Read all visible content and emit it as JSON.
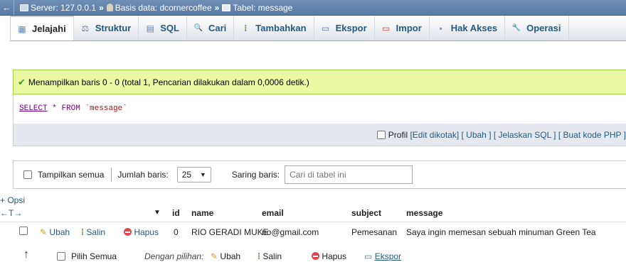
{
  "breadcrumb": {
    "back": "←",
    "server": "Server: 127.0.0.1",
    "database": "Basis data: dcornercoffee",
    "table": "Tabel: message",
    "separator": "»"
  },
  "tabs": [
    {
      "label": "Jelajahi",
      "icon": "browse-icon",
      "glyph": "▦"
    },
    {
      "label": "Struktur",
      "icon": "structure-icon",
      "glyph": "⚖"
    },
    {
      "label": "SQL",
      "icon": "sql-icon",
      "glyph": "▤"
    },
    {
      "label": "Cari",
      "icon": "search-icon",
      "glyph": "🔍"
    },
    {
      "label": "Tambahkan",
      "icon": "insert-icon",
      "glyph": "⁞"
    },
    {
      "label": "Ekspor",
      "icon": "export-icon",
      "glyph": "▭"
    },
    {
      "label": "Impor",
      "icon": "import-icon",
      "glyph": "▭"
    },
    {
      "label": "Hak Akses",
      "icon": "privileges-icon",
      "glyph": "▪"
    },
    {
      "label": "Operasi",
      "icon": "wrench-icon",
      "glyph": "🔧"
    }
  ],
  "message": {
    "text": "Menampilkan baris 0 - 0 (total 1, Pencarian dilakukan dalam 0,0006 detik.)",
    "check": "✔"
  },
  "sql": {
    "select": "SELECT",
    "star": "*",
    "from": "FROM",
    "table": "`message`"
  },
  "sql_actions": {
    "profile": "Profil",
    "edit_inline": "[Edit dikotak]",
    "edit": "[ Ubah ]",
    "explain": "[ Jelaskan SQL ]",
    "create_code": "[ Buat kode PHP ]"
  },
  "navigation": {
    "show_all": "Tampilkan semua",
    "rows_label": "Jumlah baris:",
    "rows_value": "25",
    "filter_label": "Saring baris:",
    "filter_placeholder": "Cari di tabel ini"
  },
  "options_link": "+ Opsi",
  "table": {
    "arrows": "←T→",
    "sort_arrow": "▼",
    "columns": [
      "id",
      "name",
      "email",
      "subject",
      "message"
    ],
    "rows": [
      {
        "edit": "Ubah",
        "copy": "Salin",
        "delete": "Hapus",
        "id": "0",
        "name": "RIO GERADI MUKE",
        "email": "rio@gmail.com",
        "subject": "Pemesanan",
        "message": "Saya ingin memesan sebuah minuman Green Tea"
      }
    ]
  },
  "bulk": {
    "arrow": "↑",
    "select_all": "Pilih Semua",
    "with_selected": "Dengan pilihan:",
    "edit": "Ubah",
    "copy": "Salin",
    "delete": "Hapus",
    "export": "Ekspor"
  }
}
